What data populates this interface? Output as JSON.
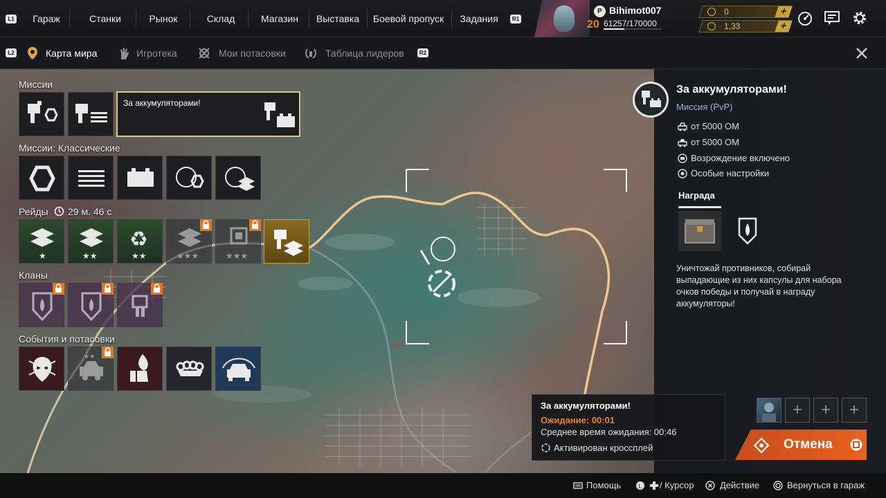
{
  "header": {
    "hint_left": "L1",
    "hint_right": "R1",
    "nav": [
      "Гараж",
      "Станки",
      "Рынок",
      "Склад",
      "Магазин",
      "Выставка",
      "Боевой пропуск",
      "Задания"
    ],
    "player": {
      "name": "Bihimot007",
      "level": "20",
      "xp": "61257/170000",
      "xp_fraction": 0.36
    },
    "currency": [
      {
        "value": "0",
        "color": "#d7b24a"
      },
      {
        "value": "1,33",
        "color": "#d7b24a"
      }
    ]
  },
  "tabs": {
    "hint_left": "L2",
    "hint_right": "R2",
    "items": [
      {
        "label": "Карта мира",
        "active": true,
        "icon": "map-pin-icon"
      },
      {
        "label": "Игротека",
        "active": false,
        "icon": "hand-icon"
      },
      {
        "label": "Мои потасовки",
        "active": false,
        "icon": "brawl-icon"
      },
      {
        "label": "Таблица лидеров",
        "active": false,
        "icon": "laurel-icon"
      }
    ]
  },
  "missions": {
    "sections": {
      "missions": "Миссии",
      "classic": "Миссии: Классические",
      "raids": "Рейды",
      "raids_timer": "29 м. 46 с",
      "clans": "Кланы",
      "events": "События и потасовки"
    },
    "selected_tile_label": "За аккумуляторами!"
  },
  "details": {
    "title": "За аккумуляторами!",
    "subtitle": "Миссия (PvP)",
    "rows": [
      {
        "icon": "car-icon",
        "text": "от 5000 ОМ"
      },
      {
        "icon": "car-outline-icon",
        "text": "от 5000 ОМ"
      },
      {
        "icon": "respawn-icon",
        "text": "Возрождение включено"
      },
      {
        "icon": "settings-special-icon",
        "text": "Особые настройки"
      }
    ],
    "reward_label": "Награда",
    "description": "Уничтожай противников, собирай выпадающие из них капсулы для набора очков победы и получай в награду аккумуляторы!"
  },
  "queue": {
    "title": "За аккумуляторами!",
    "waiting": "Ожидание: 00:01",
    "average": "Среднее время ожидания: 00:46",
    "crossplay": "Активирован кроссплей"
  },
  "cancel_label": "Отмена",
  "footer": {
    "help": "Помощь",
    "cursor": "/ Курсор",
    "action": "Действие",
    "back": "Вернуться в гараж"
  },
  "colors": {
    "accent_orange": "#e8621f",
    "lock_orange": "#e8741f",
    "gold": "#c9a23a"
  }
}
